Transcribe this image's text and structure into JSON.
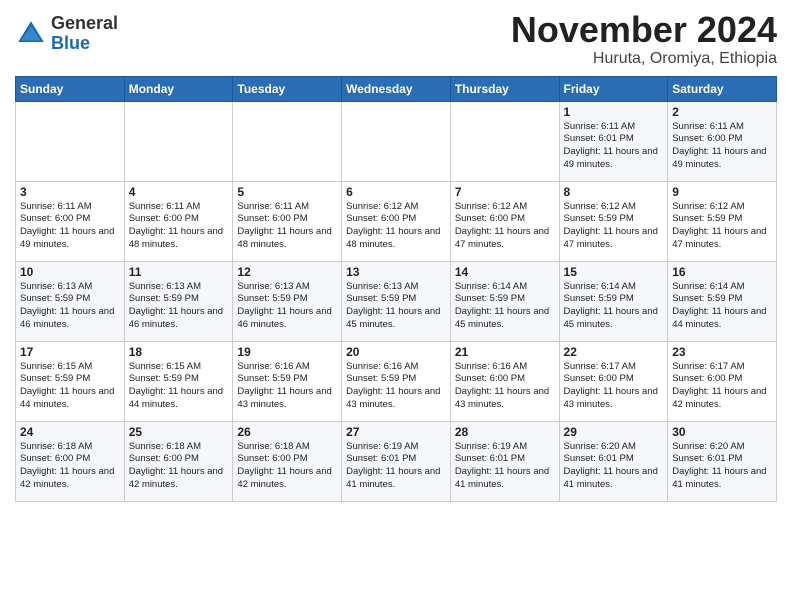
{
  "header": {
    "logo": {
      "general": "General",
      "blue": "Blue"
    },
    "title": "November 2024",
    "location": "Huruta, Oromiya, Ethiopia"
  },
  "weekdays": [
    "Sunday",
    "Monday",
    "Tuesday",
    "Wednesday",
    "Thursday",
    "Friday",
    "Saturday"
  ],
  "weeks": [
    [
      {
        "day": "",
        "content": ""
      },
      {
        "day": "",
        "content": ""
      },
      {
        "day": "",
        "content": ""
      },
      {
        "day": "",
        "content": ""
      },
      {
        "day": "",
        "content": ""
      },
      {
        "day": "1",
        "content": "Sunrise: 6:11 AM\nSunset: 6:01 PM\nDaylight: 11 hours and 49 minutes."
      },
      {
        "day": "2",
        "content": "Sunrise: 6:11 AM\nSunset: 6:00 PM\nDaylight: 11 hours and 49 minutes."
      }
    ],
    [
      {
        "day": "3",
        "content": "Sunrise: 6:11 AM\nSunset: 6:00 PM\nDaylight: 11 hours and 49 minutes."
      },
      {
        "day": "4",
        "content": "Sunrise: 6:11 AM\nSunset: 6:00 PM\nDaylight: 11 hours and 48 minutes."
      },
      {
        "day": "5",
        "content": "Sunrise: 6:11 AM\nSunset: 6:00 PM\nDaylight: 11 hours and 48 minutes."
      },
      {
        "day": "6",
        "content": "Sunrise: 6:12 AM\nSunset: 6:00 PM\nDaylight: 11 hours and 48 minutes."
      },
      {
        "day": "7",
        "content": "Sunrise: 6:12 AM\nSunset: 6:00 PM\nDaylight: 11 hours and 47 minutes."
      },
      {
        "day": "8",
        "content": "Sunrise: 6:12 AM\nSunset: 5:59 PM\nDaylight: 11 hours and 47 minutes."
      },
      {
        "day": "9",
        "content": "Sunrise: 6:12 AM\nSunset: 5:59 PM\nDaylight: 11 hours and 47 minutes."
      }
    ],
    [
      {
        "day": "10",
        "content": "Sunrise: 6:13 AM\nSunset: 5:59 PM\nDaylight: 11 hours and 46 minutes."
      },
      {
        "day": "11",
        "content": "Sunrise: 6:13 AM\nSunset: 5:59 PM\nDaylight: 11 hours and 46 minutes."
      },
      {
        "day": "12",
        "content": "Sunrise: 6:13 AM\nSunset: 5:59 PM\nDaylight: 11 hours and 46 minutes."
      },
      {
        "day": "13",
        "content": "Sunrise: 6:13 AM\nSunset: 5:59 PM\nDaylight: 11 hours and 45 minutes."
      },
      {
        "day": "14",
        "content": "Sunrise: 6:14 AM\nSunset: 5:59 PM\nDaylight: 11 hours and 45 minutes."
      },
      {
        "day": "15",
        "content": "Sunrise: 6:14 AM\nSunset: 5:59 PM\nDaylight: 11 hours and 45 minutes."
      },
      {
        "day": "16",
        "content": "Sunrise: 6:14 AM\nSunset: 5:59 PM\nDaylight: 11 hours and 44 minutes."
      }
    ],
    [
      {
        "day": "17",
        "content": "Sunrise: 6:15 AM\nSunset: 5:59 PM\nDaylight: 11 hours and 44 minutes."
      },
      {
        "day": "18",
        "content": "Sunrise: 6:15 AM\nSunset: 5:59 PM\nDaylight: 11 hours and 44 minutes."
      },
      {
        "day": "19",
        "content": "Sunrise: 6:16 AM\nSunset: 5:59 PM\nDaylight: 11 hours and 43 minutes."
      },
      {
        "day": "20",
        "content": "Sunrise: 6:16 AM\nSunset: 5:59 PM\nDaylight: 11 hours and 43 minutes."
      },
      {
        "day": "21",
        "content": "Sunrise: 6:16 AM\nSunset: 6:00 PM\nDaylight: 11 hours and 43 minutes."
      },
      {
        "day": "22",
        "content": "Sunrise: 6:17 AM\nSunset: 6:00 PM\nDaylight: 11 hours and 43 minutes."
      },
      {
        "day": "23",
        "content": "Sunrise: 6:17 AM\nSunset: 6:00 PM\nDaylight: 11 hours and 42 minutes."
      }
    ],
    [
      {
        "day": "24",
        "content": "Sunrise: 6:18 AM\nSunset: 6:00 PM\nDaylight: 11 hours and 42 minutes."
      },
      {
        "day": "25",
        "content": "Sunrise: 6:18 AM\nSunset: 6:00 PM\nDaylight: 11 hours and 42 minutes."
      },
      {
        "day": "26",
        "content": "Sunrise: 6:18 AM\nSunset: 6:00 PM\nDaylight: 11 hours and 42 minutes."
      },
      {
        "day": "27",
        "content": "Sunrise: 6:19 AM\nSunset: 6:01 PM\nDaylight: 11 hours and 41 minutes."
      },
      {
        "day": "28",
        "content": "Sunrise: 6:19 AM\nSunset: 6:01 PM\nDaylight: 11 hours and 41 minutes."
      },
      {
        "day": "29",
        "content": "Sunrise: 6:20 AM\nSunset: 6:01 PM\nDaylight: 11 hours and 41 minutes."
      },
      {
        "day": "30",
        "content": "Sunrise: 6:20 AM\nSunset: 6:01 PM\nDaylight: 11 hours and 41 minutes."
      }
    ]
  ]
}
